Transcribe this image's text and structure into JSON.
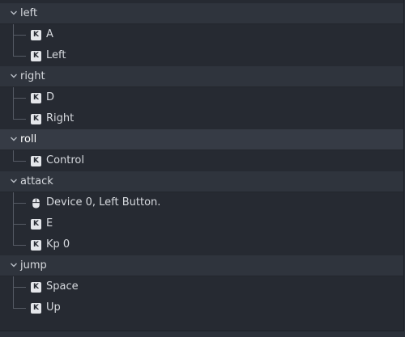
{
  "tree": {
    "actions": [
      {
        "name": "left",
        "selected": false,
        "events": [
          {
            "type": "key",
            "label": "A"
          },
          {
            "type": "key",
            "label": "Left"
          }
        ]
      },
      {
        "name": "right",
        "selected": false,
        "events": [
          {
            "type": "key",
            "label": "D"
          },
          {
            "type": "key",
            "label": "Right"
          }
        ]
      },
      {
        "name": "roll",
        "selected": true,
        "events": [
          {
            "type": "key",
            "label": "Control"
          }
        ]
      },
      {
        "name": "attack",
        "selected": false,
        "events": [
          {
            "type": "mouse",
            "label": "Device 0, Left Button."
          },
          {
            "type": "key",
            "label": "E"
          },
          {
            "type": "key",
            "label": "Kp 0"
          }
        ]
      },
      {
        "name": "jump",
        "selected": false,
        "events": [
          {
            "type": "key",
            "label": "Space"
          },
          {
            "type": "key",
            "label": "Up"
          }
        ]
      }
    ],
    "key_icon_glyph": "K",
    "icons": {
      "expanded": "chevron-down-icon",
      "key": "keyboard-key-icon",
      "mouse": "mouse-icon"
    }
  }
}
